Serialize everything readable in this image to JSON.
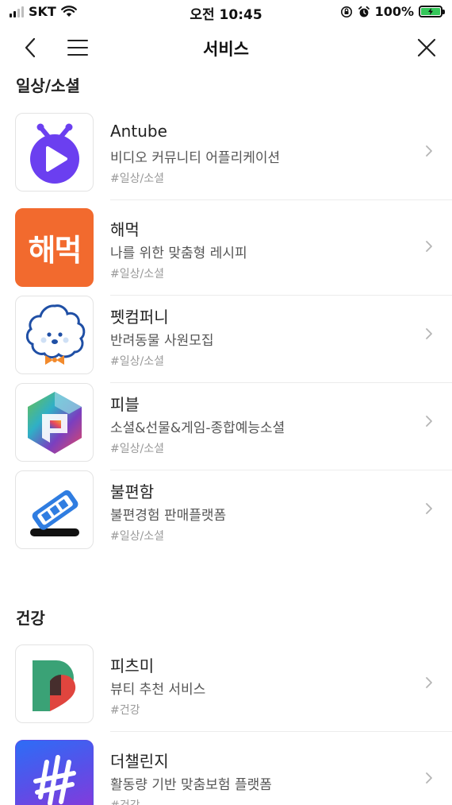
{
  "status_bar": {
    "carrier": "SKT",
    "time": "오전 10:45",
    "battery": "100%",
    "signal_level": 2
  },
  "header": {
    "title": "서비스"
  },
  "sections": [
    {
      "title": "일상/소셜",
      "items": [
        {
          "name": "Antube",
          "description": "비디오 커뮤니티 어플리케이션",
          "tag": "#일상/소셜",
          "icon": "antube-logo-icon"
        },
        {
          "name": "해먹",
          "description": "나를 위한 맞춤형 레시피",
          "tag": "#일상/소셜",
          "icon": "haemeok-logo-icon",
          "logo_text": "해먹"
        },
        {
          "name": "펫컴퍼니",
          "description": "반려동물 사원모집",
          "tag": "#일상/소셜",
          "icon": "petcompany-logo-icon"
        },
        {
          "name": "피블",
          "description": "소셜&선물&게임-종합예능소셜",
          "tag": "#일상/소셜",
          "icon": "pible-logo-icon"
        },
        {
          "name": "불편함",
          "description": "불편경험 판매플랫폼",
          "tag": "#일상/소셜",
          "icon": "bulpyeonham-logo-icon"
        }
      ]
    },
    {
      "title": "건강",
      "items": [
        {
          "name": "피츠미",
          "description": "뷰티 추천 서비스",
          "tag": "#건강",
          "icon": "pitsme-logo-icon"
        },
        {
          "name": "더챌린지",
          "description": "활동량 기반 맞춤보험 플랫폼",
          "tag": "#건강",
          "icon": "thechallenge-logo-icon"
        }
      ]
    }
  ],
  "colors": {
    "antube_purple": "#6b3ff0",
    "haemeok_orange": "#f26a2e",
    "petcompany_orange": "#f28a2c",
    "bulpyeonham_blue": "#2f7de1",
    "pitsme_green": "#3aa276",
    "pitsme_red": "#e0453e",
    "challenge_gradient_start": "#2d6df6",
    "challenge_gradient_end": "#8e36d8"
  }
}
